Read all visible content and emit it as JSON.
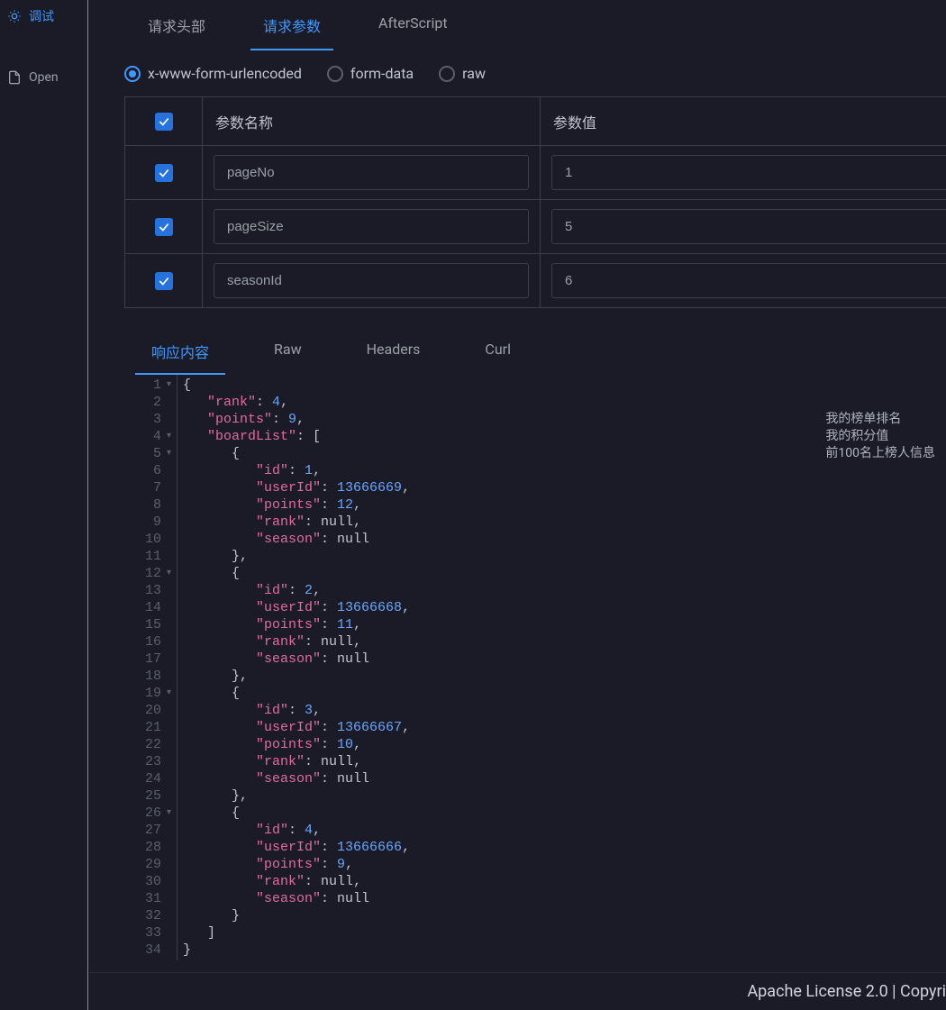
{
  "sidebar": {
    "debug": "调试",
    "open": "Open"
  },
  "request_tabs": {
    "headers": "请求头部",
    "params": "请求参数",
    "afterscript": "AfterScript"
  },
  "body_types": {
    "urlencoded": "x-www-form-urlencoded",
    "formdata": "form-data",
    "raw": "raw"
  },
  "param_table": {
    "col_name": "参数名称",
    "col_value": "参数值",
    "rows": [
      {
        "name": "pageNo",
        "value": "1"
      },
      {
        "name": "pageSize",
        "value": "5"
      },
      {
        "name": "seasonId",
        "value": "6"
      }
    ]
  },
  "response_tabs": {
    "body": "响应内容",
    "raw": "Raw",
    "headers": "Headers",
    "curl": "Curl"
  },
  "response_json": {
    "rank": 4,
    "points": 9,
    "boardList": [
      {
        "id": 1,
        "userId": 13666669,
        "points": 12,
        "rank": null,
        "season": null
      },
      {
        "id": 2,
        "userId": 13666668,
        "points": 11,
        "rank": null,
        "season": null
      },
      {
        "id": 3,
        "userId": 13666667,
        "points": 10,
        "rank": null,
        "season": null
      },
      {
        "id": 4,
        "userId": 13666666,
        "points": 9,
        "rank": null,
        "season": null
      }
    ]
  },
  "annotations": {
    "line2": "我的榜单排名",
    "line3": "我的积分值",
    "line4": "前100名上榜人信息"
  },
  "footer": "Apache License 2.0 | Copyri"
}
